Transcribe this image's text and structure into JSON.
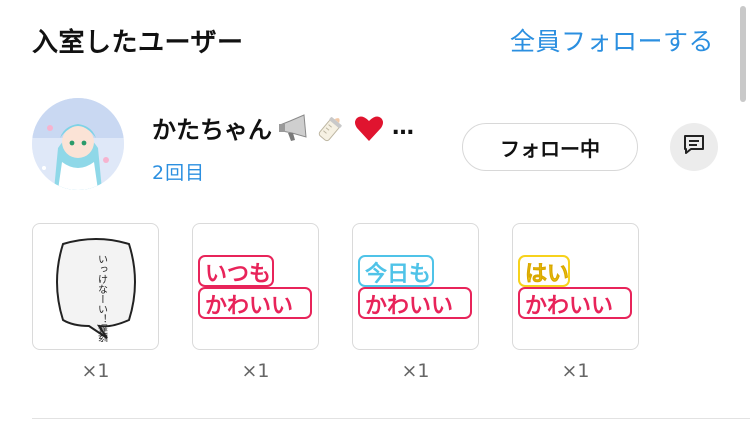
{
  "header": {
    "title": "入室したユーザー",
    "follow_all_label": "全員フォローする"
  },
  "user": {
    "name": "かたちゃん",
    "name_emojis": [
      "loudspeaker-icon",
      "baby-bottle-icon",
      "red-heart-icon"
    ],
    "ellipsis": "…",
    "visit_count": "2回目",
    "follow_button_label": "フォロー中",
    "message_icon": "comment-icon"
  },
  "stamps": [
    {
      "name": "speech-bubble-stamp",
      "text": "いっけなーい！遅刻遅刻!!",
      "count": "×1"
    },
    {
      "name": "itsumo-kawaii-stamp",
      "text": "いつもかわいい",
      "count": "×1"
    },
    {
      "name": "kyoumo-kawaii-stamp",
      "text": "今日もかわいい",
      "count": "×1"
    },
    {
      "name": "hai-kawaii-stamp",
      "text": "はいかわいい",
      "count": "×1"
    }
  ],
  "colors": {
    "accent_blue": "#2b8fe0",
    "stamp_pink": "#e8245a",
    "stamp_cyan": "#4fc3e8",
    "stamp_yellow": "#f7d21c"
  }
}
